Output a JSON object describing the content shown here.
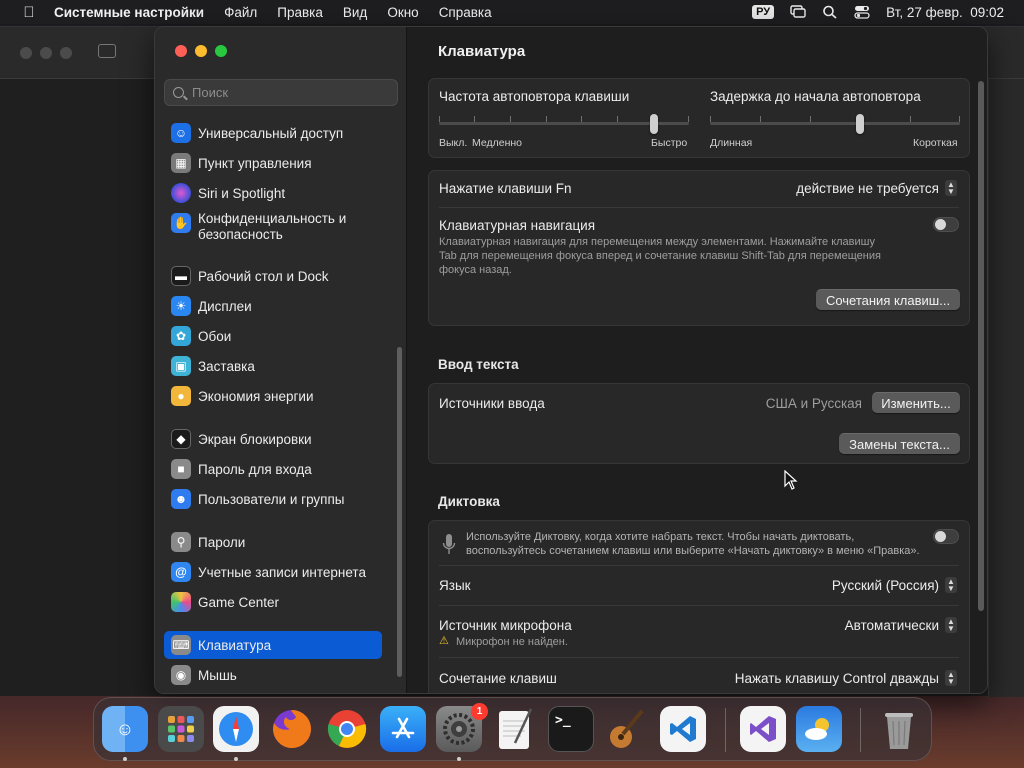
{
  "menubar": {
    "app_name": "Системные настройки",
    "menus": [
      "Файл",
      "Правка",
      "Вид",
      "Окно",
      "Справка"
    ],
    "input_source": "РУ",
    "datetime": "Вт, 27 февр.  09:02"
  },
  "sidebar": {
    "search_placeholder": "Поиск",
    "items": [
      {
        "label": "Универсальный доступ",
        "icon": "accessibility-icon",
        "color": "#1d6fe6"
      },
      {
        "label": "Пункт управления",
        "icon": "control-center-icon",
        "color": "#7a7a7a"
      },
      {
        "label": "Siri и Spotlight",
        "icon": "siri-icon",
        "color": "#c1448e"
      },
      {
        "label": "Конфиденциальность и безопасность",
        "icon": "privacy-hand-icon",
        "color": "#2f7cf0"
      },
      {
        "label": "Рабочий стол и Dock",
        "icon": "desktop-dock-icon",
        "color": "#1b1b1b"
      },
      {
        "label": "Дисплеи",
        "icon": "displays-icon",
        "color": "#2a86f0"
      },
      {
        "label": "Обои",
        "icon": "wallpaper-icon",
        "color": "#34a7d9"
      },
      {
        "label": "Заставка",
        "icon": "screensaver-icon",
        "color": "#3fb3d6"
      },
      {
        "label": "Экономия энергии",
        "icon": "energy-icon",
        "color": "#f2b63a"
      },
      {
        "label": "Экран блокировки",
        "icon": "lock-screen-icon",
        "color": "#1b1b1b"
      },
      {
        "label": "Пароль для входа",
        "icon": "login-password-icon",
        "color": "#8a8a8a"
      },
      {
        "label": "Пользователи и группы",
        "icon": "users-groups-icon",
        "color": "#2f7cf0"
      },
      {
        "label": "Пароли",
        "icon": "key-icon",
        "color": "#8a8a8a"
      },
      {
        "label": "Учетные записи интернета",
        "icon": "internet-accounts-icon",
        "color": "#2f86f0"
      },
      {
        "label": "Game Center",
        "icon": "game-center-icon",
        "color": "#e8e8e8"
      },
      {
        "label": "Клавиатура",
        "icon": "keyboard-icon",
        "color": "#8a8a8a",
        "active": true
      },
      {
        "label": "Мышь",
        "icon": "mouse-icon",
        "color": "#8a8a8a"
      }
    ]
  },
  "main": {
    "title": "Клавиатура",
    "repeat": {
      "label": "Частота автоповтора клавиши",
      "left": "Выкл.",
      "left2": "Медленно",
      "right": "Быстро",
      "value_fraction": 0.86
    },
    "delay": {
      "label": "Задержка до начала автоповтора",
      "left": "Длинная",
      "right": "Короткая",
      "value_fraction": 0.6
    },
    "fn": {
      "label": "Нажатие клавиши Fn",
      "value": "действие не требуется"
    },
    "nav": {
      "label": "Клавиатурная навигация",
      "desc1": "Клавиатурная навигация для перемещения между элементами. Нажимайте клавишу",
      "desc2": "Tab для перемещения фокуса вперед и сочетание клавиш Shift-Tab для перемещения",
      "desc3": "фокуса назад.",
      "enabled": false
    },
    "shortcuts_button": "Сочетания клавиш...",
    "text_input": {
      "title": "Ввод текста",
      "sources_label": "Источники ввода",
      "sources_value": "США и Русская",
      "change_button": "Изменить...",
      "replacements_button": "Замены текста..."
    },
    "dictation": {
      "title": "Диктовка",
      "desc1": "Используйте Диктовку, когда хотите набрать текст. Чтобы начать диктовать,",
      "desc2": "воспользуйтесь сочетанием клавиш или выберите «Начать диктовку» в меню «Правка».",
      "enabled": false,
      "language_label": "Язык",
      "language_value": "Русский (Россия)",
      "mic_label": "Источник микрофона",
      "mic_value": "Автоматически",
      "mic_warning": "Микрофон не найден.",
      "shortcut_label": "Сочетание клавиш",
      "shortcut_value": "Нажать клавишу Control дважды"
    }
  },
  "dock": {
    "apps": [
      {
        "name": "finder-icon",
        "color": "#3d8ff0",
        "running": true
      },
      {
        "name": "launchpad-icon",
        "color": "#8a8a8a",
        "running": false
      },
      {
        "name": "safari-icon",
        "color": "#2f8cf0",
        "running": true
      },
      {
        "name": "firefox-icon",
        "color": "#e0662a",
        "running": false
      },
      {
        "name": "chrome-icon",
        "color": "#e8e8e8",
        "running": false
      },
      {
        "name": "app-store-icon",
        "color": "#2a8af0",
        "running": false
      },
      {
        "name": "system-settings-icon",
        "color": "#6e6e6e",
        "running": true,
        "badge": "1"
      },
      {
        "name": "textedit-icon",
        "color": "#efefef",
        "running": false
      },
      {
        "name": "terminal-icon",
        "color": "#1a1a1a",
        "running": false
      },
      {
        "name": "garageband-icon",
        "color": "#c77a2a",
        "running": false
      },
      {
        "name": "vscode-icon",
        "color": "#1f7ad0",
        "running": false
      },
      {
        "name": "visual-studio-icon",
        "color": "#7a4fc8",
        "running": false
      },
      {
        "name": "weather-icon",
        "color": "#3a8ae0",
        "running": false
      },
      {
        "name": "trash-icon",
        "color": "#8a8a8a",
        "running": false
      }
    ]
  }
}
